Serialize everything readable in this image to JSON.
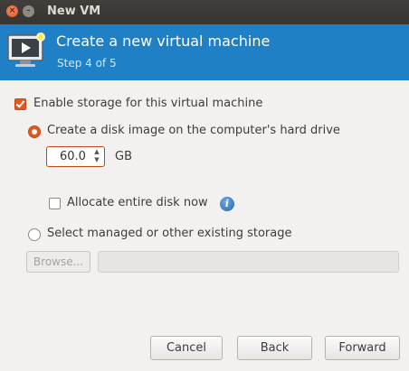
{
  "window": {
    "title": "New VM",
    "close_glyph": "×",
    "minimize_glyph": "–"
  },
  "header": {
    "title": "Create a new virtual machine",
    "step": "Step 4 of 5",
    "icon": "vm-monitor-icon",
    "background_color": "#1f80c6"
  },
  "storage": {
    "enable_label": "Enable storage for this virtual machine",
    "enable_checked": true,
    "create_disk_label": "Create a disk image on the computer's hard drive",
    "create_disk_selected": true,
    "disk_size_value": "60.0",
    "disk_size_unit": "GB",
    "allocate_label": "Allocate entire disk now",
    "allocate_checked": false,
    "info_icon": "info-icon",
    "select_existing_label": "Select managed or other existing storage",
    "select_existing_selected": false,
    "browse_label": "Browse...",
    "path_value": ""
  },
  "buttons": {
    "cancel": "Cancel",
    "back": "Back",
    "forward": "Forward"
  },
  "colors": {
    "accent": "#e5571f",
    "titlebar": "#3c3b37"
  }
}
